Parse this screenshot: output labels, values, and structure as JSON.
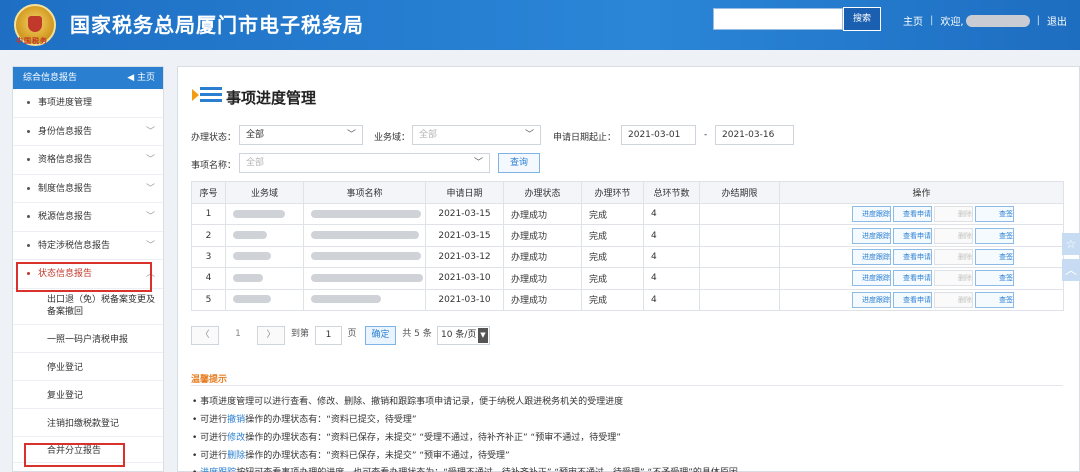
{
  "header": {
    "emblem_text": "中国税务",
    "title": "国家税务总局厦门市电子税务局",
    "search_placeholder": "",
    "search_button": "搜索",
    "home_link": "主页",
    "welcome": "欢迎,",
    "logout": "退出"
  },
  "sidebar": {
    "header": "综合信息报告",
    "home": "主页",
    "items": [
      {
        "label": "事项进度管理"
      },
      {
        "label": "身份信息报告"
      },
      {
        "label": "资格信息报告"
      },
      {
        "label": "制度信息报告"
      },
      {
        "label": "税源信息报告"
      },
      {
        "label": "特定涉税信息报告"
      },
      {
        "label": "状态信息报告"
      }
    ],
    "subitems": [
      {
        "label": "出口退（免）税备案变更及备案撤回"
      },
      {
        "label": "一照一码户清税申报"
      },
      {
        "label": "停业登记"
      },
      {
        "label": "复业登记"
      },
      {
        "label": "注销扣缴税款登记"
      },
      {
        "label": "合并分立报告"
      }
    ]
  },
  "main": {
    "title": "事项进度管理",
    "filters": {
      "status_label": "办理状态：",
      "status_value": "全部",
      "domain_label": "业务域：",
      "domain_value": "全部",
      "date_label": "申请日期起止：",
      "date_start": "2021-03-01",
      "date_dash": "-",
      "date_end": "2021-03-16",
      "item_label": "事项名称：",
      "item_value": "全部",
      "query_button": "查询"
    },
    "table": {
      "headers": [
        "序号",
        "业务域",
        "事项名称",
        "申请日期",
        "办理状态",
        "办理环节",
        "总环节数",
        "办结期限",
        "操作"
      ],
      "rows": [
        {
          "no": "1",
          "date": "2021-03-15",
          "status": "办理成功",
          "stage": "完成",
          "total": "4"
        },
        {
          "no": "2",
          "date": "2021-03-15",
          "status": "办理成功",
          "stage": "完成",
          "total": "4"
        },
        {
          "no": "3",
          "date": "2021-03-12",
          "status": "办理成功",
          "stage": "完成",
          "total": "4"
        },
        {
          "no": "4",
          "date": "2021-03-10",
          "status": "办理成功",
          "stage": "完成",
          "total": "4"
        },
        {
          "no": "5",
          "date": "2021-03-10",
          "status": "办理成功",
          "stage": "完成",
          "total": "4"
        }
      ],
      "ops": [
        "进度跟踪",
        "查看申请",
        "删除",
        "查签"
      ]
    },
    "pagination": {
      "prev": "〈",
      "page": "1",
      "next": "〉",
      "goto": "到第",
      "goto_value": "1",
      "page_unit": "页",
      "confirm": "确定",
      "total": "共 5 条",
      "per_page": "10 条/页"
    },
    "tips": {
      "title": "温馨提示",
      "lines": [
        {
          "pre": "• 事项进度管理可以进行查看、修改、删除、撤销和跟踪事项申请记录，便于纳税人跟进税务机关的受理进度",
          "hl": "",
          "post": ""
        },
        {
          "pre": "• 可进行",
          "hl": "撤销",
          "post": "操作的办理状态有：“资料已提交，待受理”"
        },
        {
          "pre": "• 可进行",
          "hl": "修改",
          "post": "操作的办理状态有：“资料已保存，未提交”  “受理不通过，待补齐补正”  “预审不通过，待受理”"
        },
        {
          "pre": "• 可进行",
          "hl": "删除",
          "post": "操作的办理状态有：“资料已保存，未提交”  “预审不通过，待受理”"
        },
        {
          "pre": "• ",
          "hl": "进度跟踪",
          "post": "按钮可查看事项办理的进度，也可查看办理状态为：“受理不通过，待补齐补正”  “预审不通过，待受理”  “不予受理”的具体原因"
        }
      ]
    }
  },
  "colors": {
    "header_blue": "#2b86d8",
    "accent_blue": "#2a7fd1",
    "highlight_red": "#d9312c",
    "tips_orange": "#e67e22"
  }
}
